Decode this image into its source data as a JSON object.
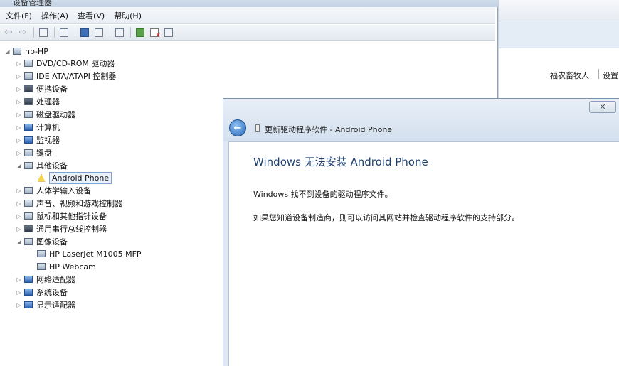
{
  "window_title": "设备管理器",
  "menu": [
    "文件(F)",
    "操作(A)",
    "查看(V)",
    "帮助(H)"
  ],
  "background_window": {
    "user_name": "福农畜牧人",
    "settings_link": "设置"
  },
  "tree": {
    "root": "hp-HP",
    "items": [
      {
        "label": "DVD/CD-ROM 驱动器",
        "icon": "dvd-drive-icon"
      },
      {
        "label": "IDE ATA/ATAPI 控制器",
        "icon": "ide-controller-icon"
      },
      {
        "label": "便携设备",
        "icon": "portable-device-icon"
      },
      {
        "label": "处理器",
        "icon": "processor-icon"
      },
      {
        "label": "磁盘驱动器",
        "icon": "disk-drive-icon"
      },
      {
        "label": "计算机",
        "icon": "computer-icon"
      },
      {
        "label": "监视器",
        "icon": "monitor-icon"
      },
      {
        "label": "键盘",
        "icon": "keyboard-icon"
      },
      {
        "label": "其他设备",
        "icon": "other-devices-icon",
        "expanded": true,
        "children": [
          {
            "label": "Android Phone",
            "icon": "warning-device-icon",
            "selected": true
          }
        ]
      },
      {
        "label": "人体学输入设备",
        "icon": "hid-icon"
      },
      {
        "label": "声音、视频和游戏控制器",
        "icon": "sound-icon"
      },
      {
        "label": "鼠标和其他指针设备",
        "icon": "mouse-icon"
      },
      {
        "label": "通用串行总线控制器",
        "icon": "usb-icon"
      },
      {
        "label": "图像设备",
        "icon": "imaging-device-icon",
        "expanded": true,
        "children": [
          {
            "label": "HP LaserJet M1005 MFP",
            "icon": "scanner-icon"
          },
          {
            "label": "HP Webcam",
            "icon": "webcam-icon"
          }
        ]
      },
      {
        "label": "网络适配器",
        "icon": "network-adapter-icon"
      },
      {
        "label": "系统设备",
        "icon": "system-device-icon"
      },
      {
        "label": "显示适配器",
        "icon": "display-adapter-icon"
      }
    ]
  },
  "dialog": {
    "title": "更新驱动程序软件 - Android Phone",
    "close": "✕",
    "headline": "Windows 无法安装 Android Phone",
    "message1": "Windows 找不到设备的驱动程序文件。",
    "message2": "如果您知道设备制造商，则可以访问其网站并检查驱动程序软件的支持部分。"
  }
}
